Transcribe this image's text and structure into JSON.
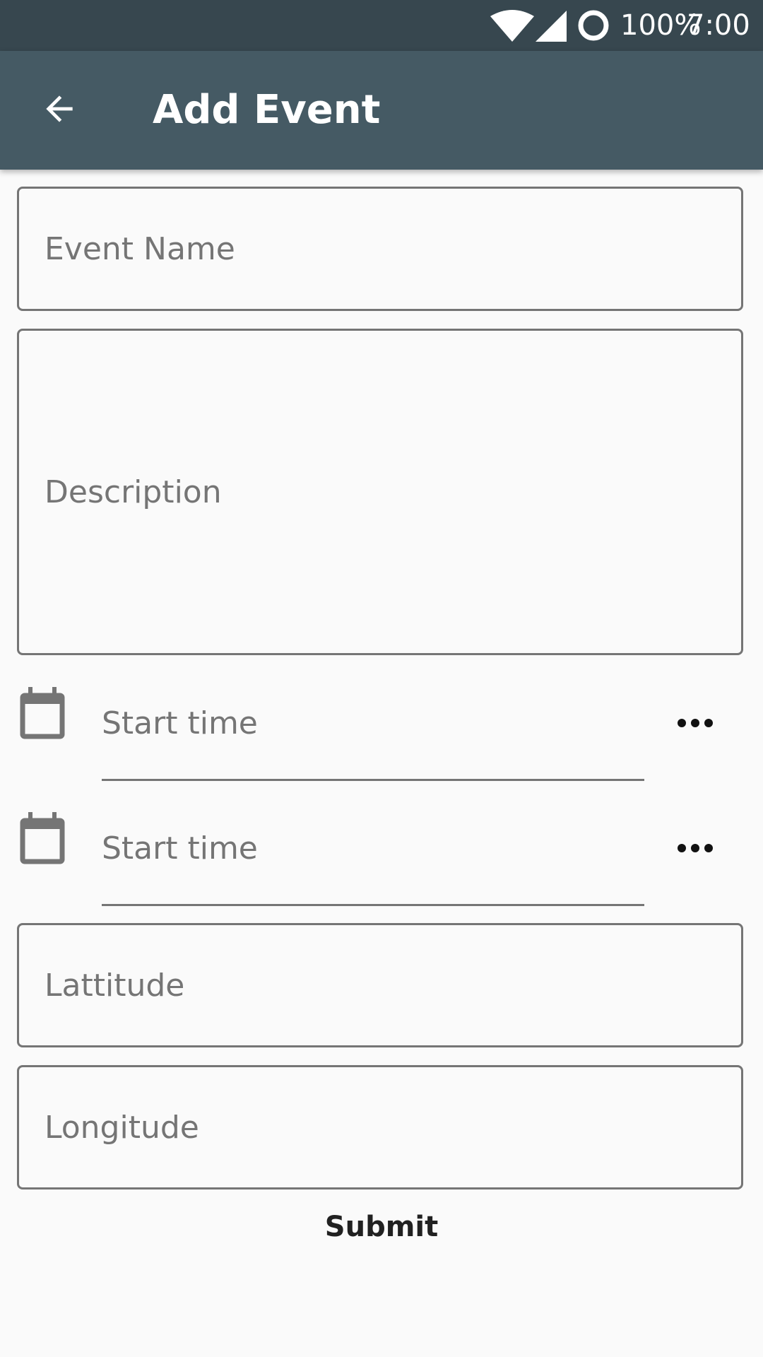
{
  "status_bar": {
    "battery_text": "100%",
    "time": "7:00",
    "icons": [
      "wifi-icon",
      "signal-icon",
      "battery-ring-icon"
    ]
  },
  "app_bar": {
    "title": "Add Event",
    "back_icon": "arrow-back-icon",
    "background_color": "#455a64"
  },
  "form": {
    "event_name": {
      "placeholder": "Event Name",
      "value": ""
    },
    "description": {
      "placeholder": "Description",
      "value": ""
    },
    "start_time_1": {
      "placeholder": "Start time",
      "icon": "calendar-icon",
      "action_icon": "more-horiz-icon"
    },
    "start_time_2": {
      "placeholder": "Start time",
      "icon": "calendar-icon",
      "action_icon": "more-horiz-icon"
    },
    "latitude": {
      "placeholder": "Lattitude",
      "value": ""
    },
    "longitude": {
      "placeholder": "Longitude",
      "value": ""
    },
    "submit_label": "Submit"
  },
  "colors": {
    "status_bar": "#37474f",
    "app_bar": "#455a64",
    "background": "#fafafa",
    "hint_text": "#757575",
    "outline": "#757575"
  }
}
